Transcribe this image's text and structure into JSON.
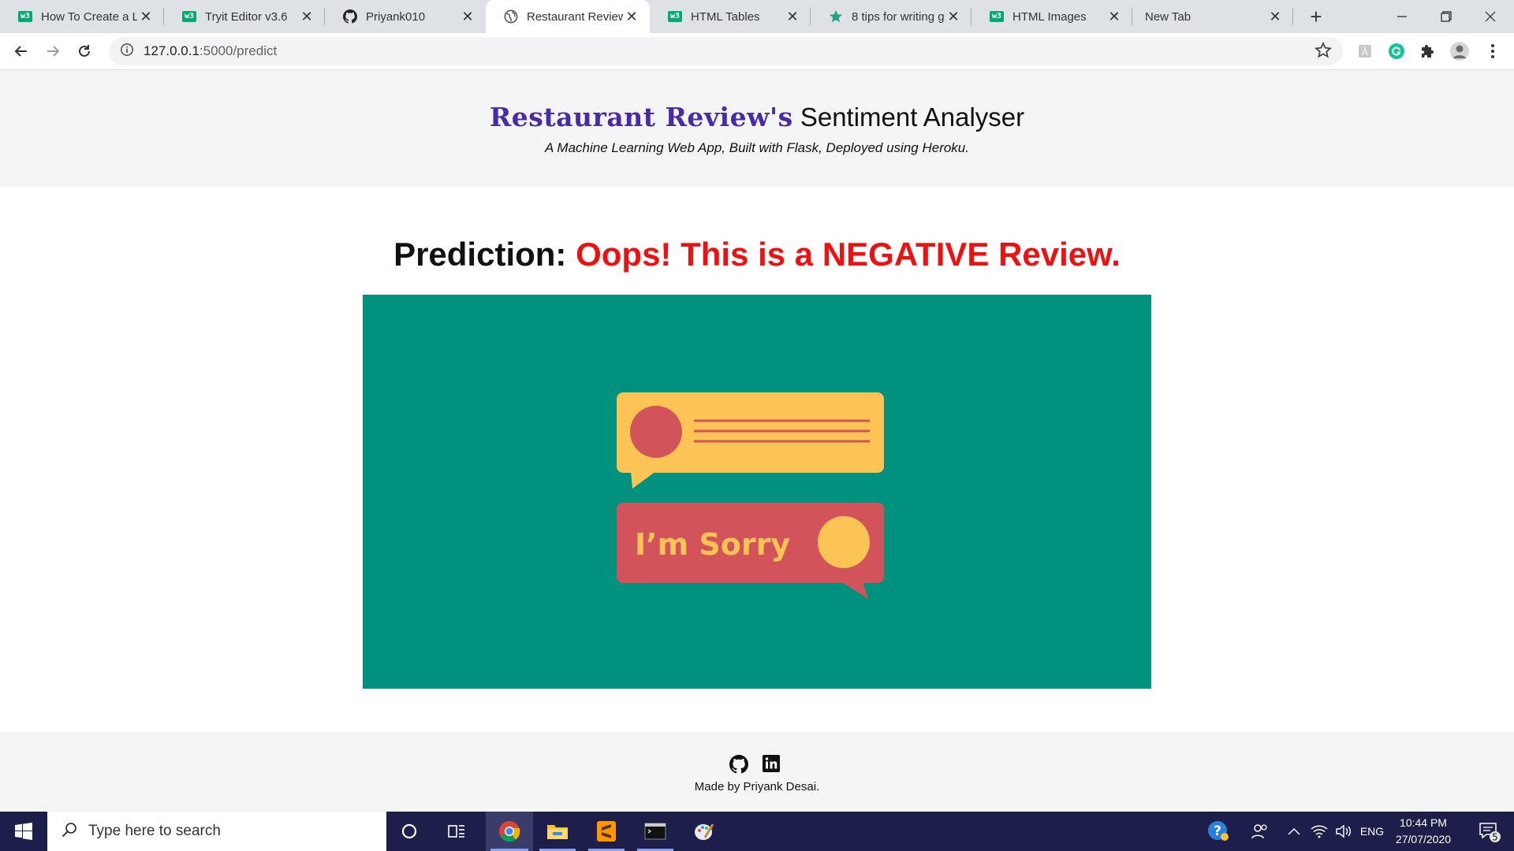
{
  "browser": {
    "tabs": [
      {
        "title": "How To Create a Lo",
        "favicon": "w3schools-icon",
        "active": false
      },
      {
        "title": "Tryit Editor v3.6",
        "favicon": "w3schools-icon",
        "active": false
      },
      {
        "title": "Priyank010",
        "favicon": "github-icon",
        "active": false
      },
      {
        "title": "Restaurant Review",
        "favicon": "globe-icon",
        "active": true
      },
      {
        "title": "HTML Tables",
        "favicon": "w3schools-icon",
        "active": false
      },
      {
        "title": "8 tips for writing g",
        "favicon": "star-icon",
        "active": false
      },
      {
        "title": "HTML Images",
        "favicon": "w3schools-icon",
        "active": false
      },
      {
        "title": "New Tab",
        "favicon": "",
        "active": false
      }
    ],
    "favicon_label": "w3",
    "new_tab_symbol": "+",
    "url_host": "127.0.0.1",
    "url_path": ":5000/predict",
    "accent_color": "#4a2aa6"
  },
  "header": {
    "brand_part1": "Restaurant Review's",
    "brand_part2": "Sentiment Analyser",
    "subtitle": "A Machine Learning Web App, Built with Flask, Deployed using Heroku."
  },
  "result": {
    "label": "Prediction:",
    "value": "Oops! This is a NEGATIVE Review.",
    "value_color": "#ee1111",
    "image_text": "I’m Sorry"
  },
  "footer": {
    "credit": "Made by Priyank Desai."
  },
  "taskbar": {
    "search_placeholder": "Type here to search",
    "language": "ENG",
    "time": "10:44 PM",
    "date": "27/07/2020",
    "notification_count": "5"
  }
}
